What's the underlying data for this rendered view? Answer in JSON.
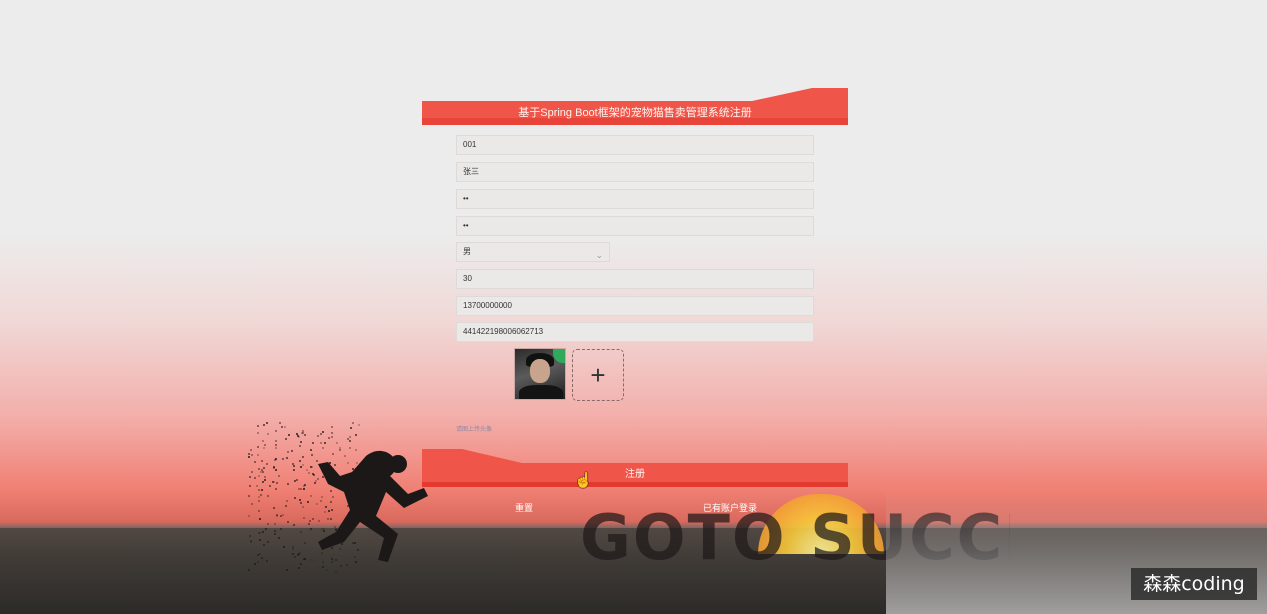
{
  "page": {
    "title": "基于Spring Boot框架的宠物猫售卖管理系统注册"
  },
  "form": {
    "fields": [
      {
        "value": "001"
      },
      {
        "value": "张三"
      },
      {
        "value": "••"
      },
      {
        "value": "••"
      },
      {
        "value": "30"
      },
      {
        "value": "13700000000"
      },
      {
        "value": "441422198006062713"
      }
    ],
    "gender": {
      "selected": "男",
      "icon": "chevron-down-icon"
    },
    "upload": {
      "add_icon": "+",
      "hint": "请图上传头像"
    }
  },
  "actions": {
    "register_label": "注册",
    "reset_label": "重置",
    "login_label": "已有账户登录"
  },
  "background": {
    "slogan": "GOTO SUCCESS"
  },
  "watermark": "森森coding",
  "colors": {
    "accent": "#f0554a",
    "accent_dark": "#e23a2e"
  }
}
